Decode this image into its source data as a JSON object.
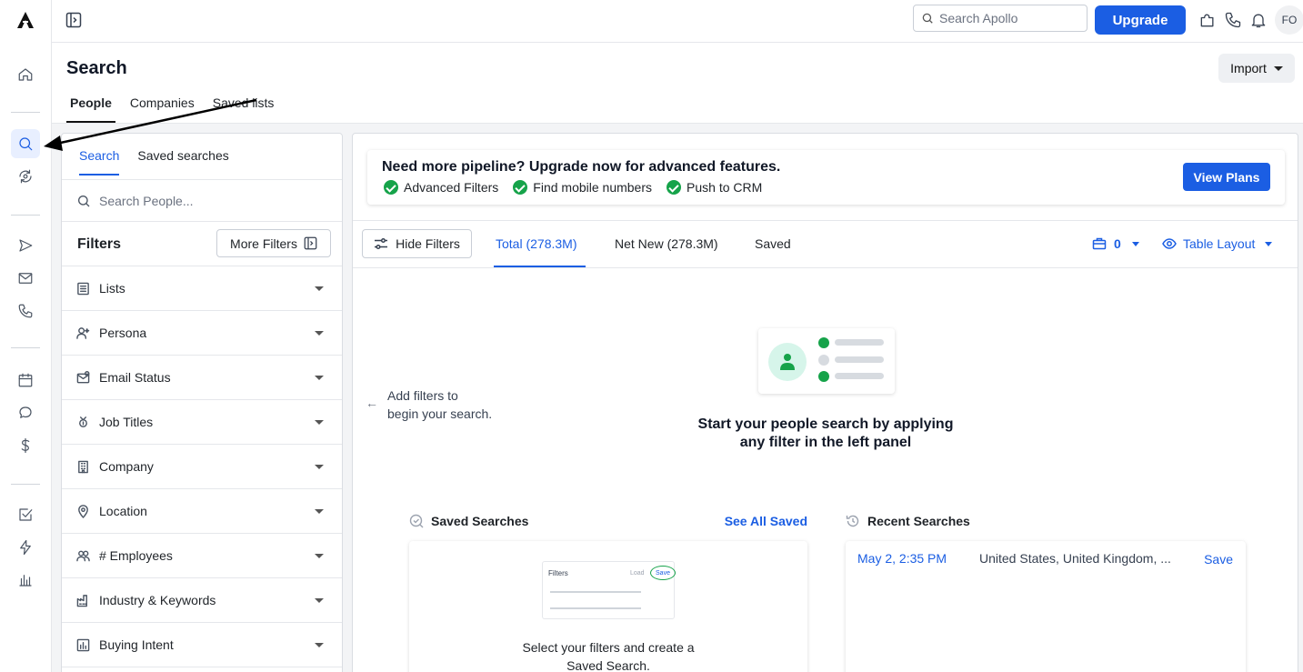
{
  "topbar": {
    "search_placeholder": "Search Apollo",
    "upgrade_label": "Upgrade",
    "avatar_initials": "FO"
  },
  "header": {
    "title": "Search",
    "import_label": "Import",
    "tabs": [
      {
        "label": "People",
        "active": true
      },
      {
        "label": "Companies",
        "active": false
      },
      {
        "label": "Saved lists",
        "active": false
      }
    ]
  },
  "filter_panel": {
    "tabs": [
      {
        "label": "Search",
        "active": true
      },
      {
        "label": "Saved searches",
        "active": false
      }
    ],
    "search_placeholder": "Search People...",
    "filters_title": "Filters",
    "more_filters_label": "More Filters",
    "filters": [
      {
        "label": "Lists",
        "icon": "list-icon"
      },
      {
        "label": "Persona",
        "icon": "persona-icon"
      },
      {
        "label": "Email Status",
        "icon": "email-status-icon"
      },
      {
        "label": "Job Titles",
        "icon": "job-title-icon"
      },
      {
        "label": "Company",
        "icon": "building-icon"
      },
      {
        "label": "Location",
        "icon": "location-pin-icon"
      },
      {
        "label": "# Employees",
        "icon": "employees-icon"
      },
      {
        "label": "Industry & Keywords",
        "icon": "industry-icon"
      },
      {
        "label": "Buying Intent",
        "icon": "bar-chart-icon"
      }
    ]
  },
  "banner": {
    "title": "Need more pipeline? Upgrade now for advanced features.",
    "features": [
      "Advanced Filters",
      "Find mobile numbers",
      "Push to CRM"
    ],
    "cta_label": "View Plans"
  },
  "results": {
    "hide_filters_label": "Hide Filters",
    "tabs": [
      {
        "label": "Total (278.3M)",
        "active": true
      },
      {
        "label": "Net New (278.3M)",
        "active": false
      },
      {
        "label": "Saved",
        "active": false
      }
    ],
    "count_value": "0",
    "layout_label": "Table Layout",
    "hint_line1": "Add filters to",
    "hint_line2": "begin your search.",
    "empty_line1": "Start your people search by applying",
    "empty_line2": "any filter in the left panel"
  },
  "saved_searches": {
    "title": "Saved Searches",
    "see_all_label": "See All Saved",
    "mini_filters": "Filters",
    "mini_load": "Load",
    "mini_save": "Save",
    "message_line1": "Select your filters and create a",
    "message_line2": "Saved Search."
  },
  "recent_searches": {
    "title": "Recent Searches",
    "items": [
      {
        "date": "May 2, 2:35 PM",
        "description": "United States, United Kingdom, ...",
        "action": "Save"
      }
    ]
  },
  "colors": {
    "accent": "#1b5ee3",
    "success": "#16a34a"
  }
}
